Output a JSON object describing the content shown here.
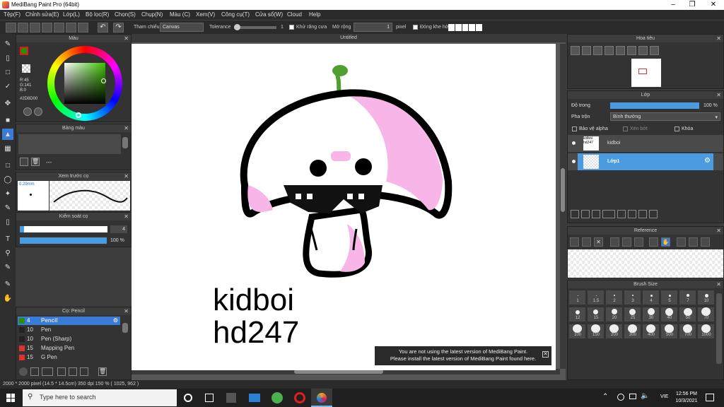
{
  "window": {
    "title": "MediBang Paint Pro (64bit)"
  },
  "menu": [
    "Tệp(F)",
    "Chỉnh sửa(E)",
    "Lớp(L)",
    "Bộ lọc(R)",
    "Chọn(S)",
    "Chụp(N)",
    "Màu (C)",
    "Xem(V)",
    "Công cụ(T)",
    "Cửa sổ(W)",
    "Cloud",
    "Help"
  ],
  "toolbar": {
    "reference_label": "Tham chiếu",
    "reference_value": "Canvas",
    "tolerance_label": "Tolerance",
    "tolerance_value": "1",
    "antialias_label": "Khử răng cưa",
    "expand_label": "Mở rộng",
    "expand_value": "1",
    "expand_unit": "pixel",
    "close_gap_label": "Đóng khe hở"
  },
  "color_panel": {
    "title": "Màu",
    "rgb": [
      "R:45",
      "G:141",
      "B:0"
    ],
    "hex": "#2D8D00",
    "primary_color": "#2d8d00"
  },
  "palette_panel": {
    "title": "Bảng màu",
    "value": "---"
  },
  "brush_preview": {
    "title": "Xem trước cọ",
    "size": "0.29mm"
  },
  "brush_control": {
    "title": "Kiểm soát cọ",
    "size": "4",
    "opacity": "100 %"
  },
  "brush_list": {
    "title": "Cọ: Pencil",
    "items": [
      {
        "size": "4",
        "name": "Pencil",
        "color": "#2d8d00",
        "selected": true
      },
      {
        "size": "10",
        "name": "Pen",
        "color": "#222222",
        "selected": false
      },
      {
        "size": "10",
        "name": "Pen (Sharp)",
        "color": "#222222",
        "selected": false
      },
      {
        "size": "15",
        "name": "Mapping Pen",
        "color": "#e03030",
        "selected": false
      },
      {
        "size": "15",
        "name": "G Pen",
        "color": "#e03030",
        "selected": false
      }
    ]
  },
  "canvas": {
    "tab_title": "Untitled",
    "text_line1": "kidboi",
    "text_line2": "hd247"
  },
  "notice": {
    "line1": "You are not using the latest version of MediBang Paint.",
    "line2": "Please install the latest version of MediBang Paint found here."
  },
  "navigator": {
    "title": "Hoa tiêu"
  },
  "layers": {
    "title": "Lớp",
    "opacity_label": "Độ trong",
    "opacity_value": "100 %",
    "opacity_fraction": 1.0,
    "blend_label": "Pha trộn",
    "blend_value": "Bình thường",
    "protect_alpha": "Bảo vệ alpha",
    "clip": "Xén bớt",
    "lock": "Khóa",
    "items": [
      {
        "thumb": "kidboi hd247",
        "name": "kidboi",
        "selected": false
      },
      {
        "thumb": "",
        "name": "Lớp1",
        "selected": true
      }
    ]
  },
  "reference_panel": {
    "title": "Reference"
  },
  "brush_size": {
    "title": "Brush Size",
    "sizes": [
      "1",
      "1.5",
      "2",
      "3",
      "4",
      "5",
      "7",
      "10",
      "12",
      "15",
      "20",
      "25",
      "30",
      "40",
      "50",
      "70",
      "100",
      "150",
      "200",
      "300",
      "400",
      "500",
      "700",
      "1000"
    ]
  },
  "status": "2000 * 2000 pixel   (14.5 * 14.5cm)   350 dpi   150 %   ( 1025, 962 )",
  "taskbar": {
    "search_placeholder": "Type here to search",
    "lang": "VIE",
    "time": "12:56 PM",
    "date": "10/3/2021"
  }
}
